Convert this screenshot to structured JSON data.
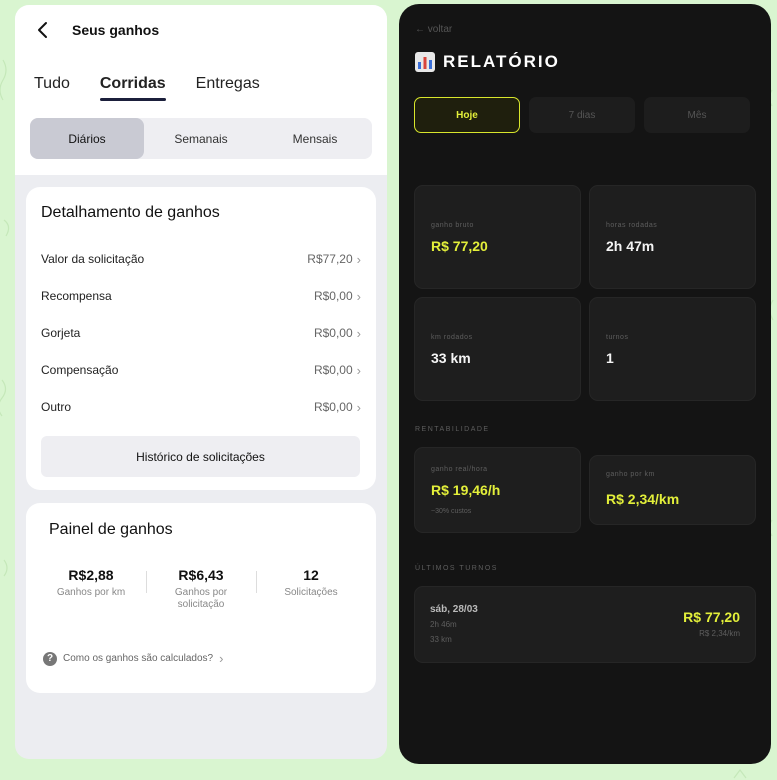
{
  "left": {
    "title": "Seus ganhos",
    "tabs": [
      "Tudo",
      "Corridas",
      "Entregas"
    ],
    "segments": [
      "Diários",
      "Semanais",
      "Mensais"
    ],
    "breakdown": {
      "title": "Detalhamento de ganhos",
      "rows": [
        {
          "label": "Valor da solicitação",
          "value": "R$77,20"
        },
        {
          "label": "Recompensa",
          "value": "R$0,00"
        },
        {
          "label": "Gorjeta",
          "value": "R$0,00"
        },
        {
          "label": "Compensação",
          "value": "R$0,00"
        },
        {
          "label": "Outro",
          "value": "R$0,00"
        }
      ],
      "history_button": "Histórico de solicitações"
    },
    "panel": {
      "title": "Painel de ganhos",
      "stats": [
        {
          "value": "R$2,88",
          "label": "Ganhos por km"
        },
        {
          "value": "R$6,43",
          "label": "Ganhos por solicitação"
        },
        {
          "value": "12",
          "label": "Solicitações"
        }
      ],
      "help_text": "Como os ganhos são calculados?"
    }
  },
  "right": {
    "back": "← voltar",
    "title": "RELATÓRIO",
    "periods": [
      "Hoje",
      "7 dias",
      "Mês"
    ],
    "tiles": [
      {
        "label": "ganho bruto",
        "value": "R$ 77,20"
      },
      {
        "label": "horas rodadas",
        "value": "2h 47m"
      },
      {
        "label": "km rodados",
        "value": "33 km"
      },
      {
        "label": "turnos",
        "value": "1"
      }
    ],
    "rent_section": "RENTABILIDADE",
    "rent_tiles": [
      {
        "label": "ganho real/hora",
        "value": "R$ 19,46/h",
        "sub": "~30% custos"
      },
      {
        "label": "ganho por km",
        "value": "R$ 2,34/km"
      }
    ],
    "shifts_section": "ÚLTIMOS TURNOS",
    "shift": {
      "date": "sáb, 28/03",
      "hours": "2h 46m",
      "km": "33 km",
      "value": "R$ 77,20",
      "rate": "R$ 2,34/km"
    },
    "accent_color": "#e3ef3a"
  }
}
